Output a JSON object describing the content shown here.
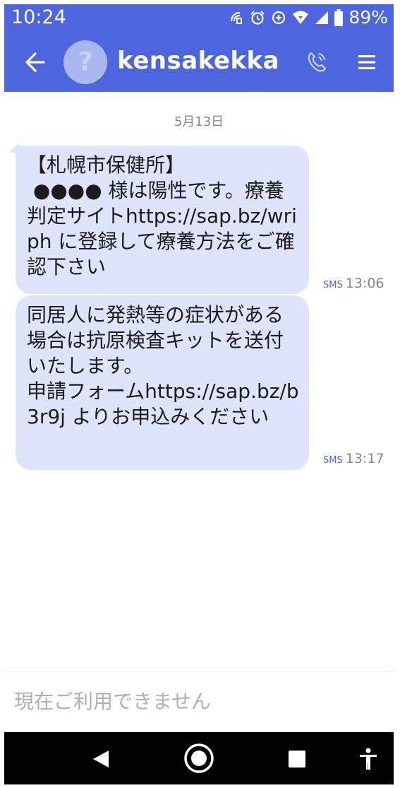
{
  "status_bar": {
    "time": "10:24",
    "battery": "89%",
    "icons": [
      "nfc-icon",
      "alarm-icon",
      "data-saver-icon",
      "wifi-icon",
      "signal-icon",
      "battery-icon"
    ]
  },
  "header": {
    "avatar_mark": "?",
    "contact_name": "kensakekka",
    "icons": [
      "back-arrow-icon",
      "phone-icon",
      "menu-icon"
    ]
  },
  "conversation": {
    "date": "5月13日",
    "messages": [
      {
        "text": "【札幌市保健所】\n ●●●● 様は陽性です。療養判定サイトhttps://sap.bz/wriph に登録して療養方法をご確認下さい",
        "channel": "SMS",
        "time": "13:06"
      },
      {
        "text": "同居人に発熱等の症状がある場合は抗原検査キットを送付いたします。\n申請フォームhttps://sap.bz/b3r9j よりお申込みください",
        "channel": "SMS",
        "time": "13:17"
      }
    ]
  },
  "composer": {
    "placeholder": "現在ご利用できません"
  },
  "nav_bar": {
    "icons": [
      "nav-back-icon",
      "nav-home-icon",
      "nav-recents-icon",
      "accessibility-icon"
    ]
  },
  "colors": {
    "accent": "#4d66e0",
    "bubble": "#dde4fb",
    "avatar": "#a9b7f1",
    "meta_text": "#888888"
  }
}
